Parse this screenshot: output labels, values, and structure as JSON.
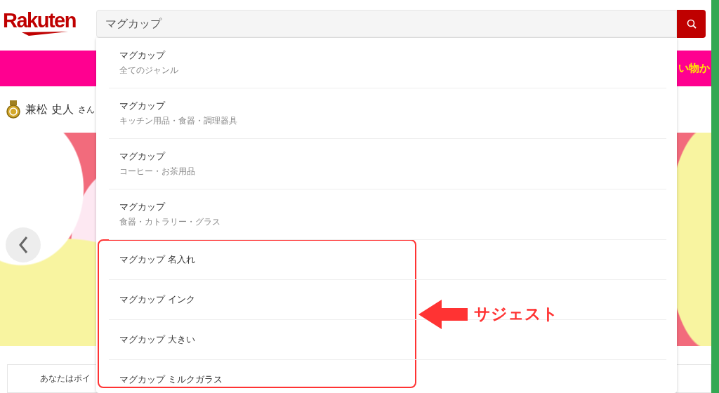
{
  "header": {
    "logo": "Rakuten",
    "search": {
      "value": "マグカップ"
    }
  },
  "banner": {
    "text": "い物か"
  },
  "user": {
    "name": "兼松 史人",
    "suffix": "さん"
  },
  "points_notice": "あなたはポイ",
  "dropdown": [
    {
      "kind": "genre",
      "title": "マグカップ",
      "genre": "全てのジャンル"
    },
    {
      "kind": "genre",
      "title": "マグカップ",
      "genre": "キッチン用品・食器・調理器具"
    },
    {
      "kind": "genre",
      "title": "マグカップ",
      "genre": "コーヒー・お茶用品"
    },
    {
      "kind": "genre",
      "title": "マグカップ",
      "genre": "食器・カトラリー・グラス"
    },
    {
      "kind": "suggestion",
      "title": "マグカップ 名入れ"
    },
    {
      "kind": "suggestion",
      "title": "マグカップ インク"
    },
    {
      "kind": "suggestion",
      "title": "マグカップ 大きい"
    },
    {
      "kind": "suggestion",
      "title": "マグカップ ミルクガラス"
    }
  ],
  "annotation": {
    "label": "サジェスト"
  }
}
